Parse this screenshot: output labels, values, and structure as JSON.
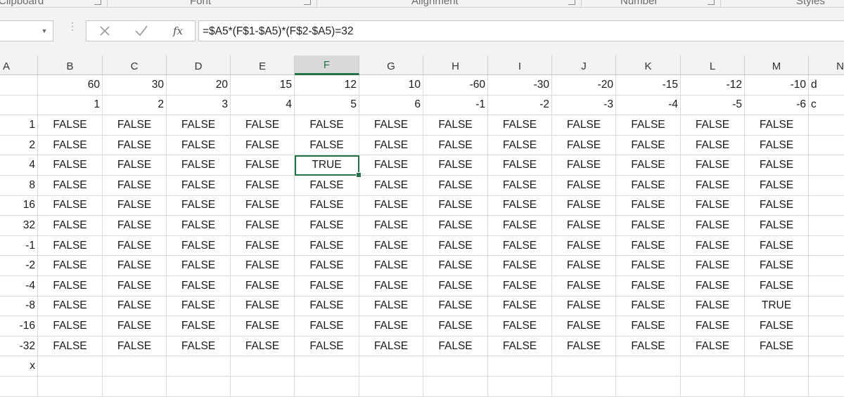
{
  "ribbon": {
    "groups": [
      "Clipboard",
      "Font",
      "Alignment",
      "Number",
      "Styles"
    ]
  },
  "formula_bar": {
    "name_box_value": "",
    "cancel_icon": "close-icon",
    "enter_icon": "check-icon",
    "function_label": "fx",
    "formula": "=$A5*(F$1-$A5)*(F$2-$A5)=32"
  },
  "columns": [
    "A",
    "B",
    "C",
    "D",
    "E",
    "F",
    "G",
    "H",
    "I",
    "J",
    "K",
    "L",
    "M",
    "N"
  ],
  "selected_column": "F",
  "active_cell": "F5",
  "rows": [
    {
      "a": "",
      "cells": [
        "60",
        "30",
        "20",
        "15",
        "12",
        "10",
        "-60",
        "-30",
        "-20",
        "-15",
        "-12",
        "-10"
      ],
      "n": "d"
    },
    {
      "a": "",
      "cells": [
        "1",
        "2",
        "3",
        "4",
        "5",
        "6",
        "-1",
        "-2",
        "-3",
        "-4",
        "-5",
        "-6"
      ],
      "n": "c"
    },
    {
      "a": "1",
      "cells": [
        "FALSE",
        "FALSE",
        "FALSE",
        "FALSE",
        "FALSE",
        "FALSE",
        "FALSE",
        "FALSE",
        "FALSE",
        "FALSE",
        "FALSE",
        "FALSE"
      ],
      "n": ""
    },
    {
      "a": "2",
      "cells": [
        "FALSE",
        "FALSE",
        "FALSE",
        "FALSE",
        "FALSE",
        "FALSE",
        "FALSE",
        "FALSE",
        "FALSE",
        "FALSE",
        "FALSE",
        "FALSE"
      ],
      "n": ""
    },
    {
      "a": "4",
      "cells": [
        "FALSE",
        "FALSE",
        "FALSE",
        "FALSE",
        "TRUE",
        "FALSE",
        "FALSE",
        "FALSE",
        "FALSE",
        "FALSE",
        "FALSE",
        "FALSE"
      ],
      "n": ""
    },
    {
      "a": "8",
      "cells": [
        "FALSE",
        "FALSE",
        "FALSE",
        "FALSE",
        "FALSE",
        "FALSE",
        "FALSE",
        "FALSE",
        "FALSE",
        "FALSE",
        "FALSE",
        "FALSE"
      ],
      "n": ""
    },
    {
      "a": "16",
      "cells": [
        "FALSE",
        "FALSE",
        "FALSE",
        "FALSE",
        "FALSE",
        "FALSE",
        "FALSE",
        "FALSE",
        "FALSE",
        "FALSE",
        "FALSE",
        "FALSE"
      ],
      "n": ""
    },
    {
      "a": "32",
      "cells": [
        "FALSE",
        "FALSE",
        "FALSE",
        "FALSE",
        "FALSE",
        "FALSE",
        "FALSE",
        "FALSE",
        "FALSE",
        "FALSE",
        "FALSE",
        "FALSE"
      ],
      "n": ""
    },
    {
      "a": "-1",
      "cells": [
        "FALSE",
        "FALSE",
        "FALSE",
        "FALSE",
        "FALSE",
        "FALSE",
        "FALSE",
        "FALSE",
        "FALSE",
        "FALSE",
        "FALSE",
        "FALSE"
      ],
      "n": ""
    },
    {
      "a": "-2",
      "cells": [
        "FALSE",
        "FALSE",
        "FALSE",
        "FALSE",
        "FALSE",
        "FALSE",
        "FALSE",
        "FALSE",
        "FALSE",
        "FALSE",
        "FALSE",
        "FALSE"
      ],
      "n": ""
    },
    {
      "a": "-4",
      "cells": [
        "FALSE",
        "FALSE",
        "FALSE",
        "FALSE",
        "FALSE",
        "FALSE",
        "FALSE",
        "FALSE",
        "FALSE",
        "FALSE",
        "FALSE",
        "FALSE"
      ],
      "n": ""
    },
    {
      "a": "-8",
      "cells": [
        "FALSE",
        "FALSE",
        "FALSE",
        "FALSE",
        "FALSE",
        "FALSE",
        "FALSE",
        "FALSE",
        "FALSE",
        "FALSE",
        "FALSE",
        "TRUE"
      ],
      "n": ""
    },
    {
      "a": "-16",
      "cells": [
        "FALSE",
        "FALSE",
        "FALSE",
        "FALSE",
        "FALSE",
        "FALSE",
        "FALSE",
        "FALSE",
        "FALSE",
        "FALSE",
        "FALSE",
        "FALSE"
      ],
      "n": ""
    },
    {
      "a": "-32",
      "cells": [
        "FALSE",
        "FALSE",
        "FALSE",
        "FALSE",
        "FALSE",
        "FALSE",
        "FALSE",
        "FALSE",
        "FALSE",
        "FALSE",
        "FALSE",
        "FALSE"
      ],
      "n": ""
    },
    {
      "a": "x",
      "cells": [
        "",
        "",
        "",
        "",
        "",
        "",
        "",
        "",
        "",
        "",
        "",
        ""
      ],
      "n": ""
    },
    {
      "a": "",
      "cells": [
        "",
        "",
        "",
        "",
        "",
        "",
        "",
        "",
        "",
        "",
        "",
        ""
      ],
      "n": ""
    }
  ],
  "colors": {
    "accent": "#217346",
    "header_bg": "#f3f3f3",
    "gridline": "#dadada"
  }
}
